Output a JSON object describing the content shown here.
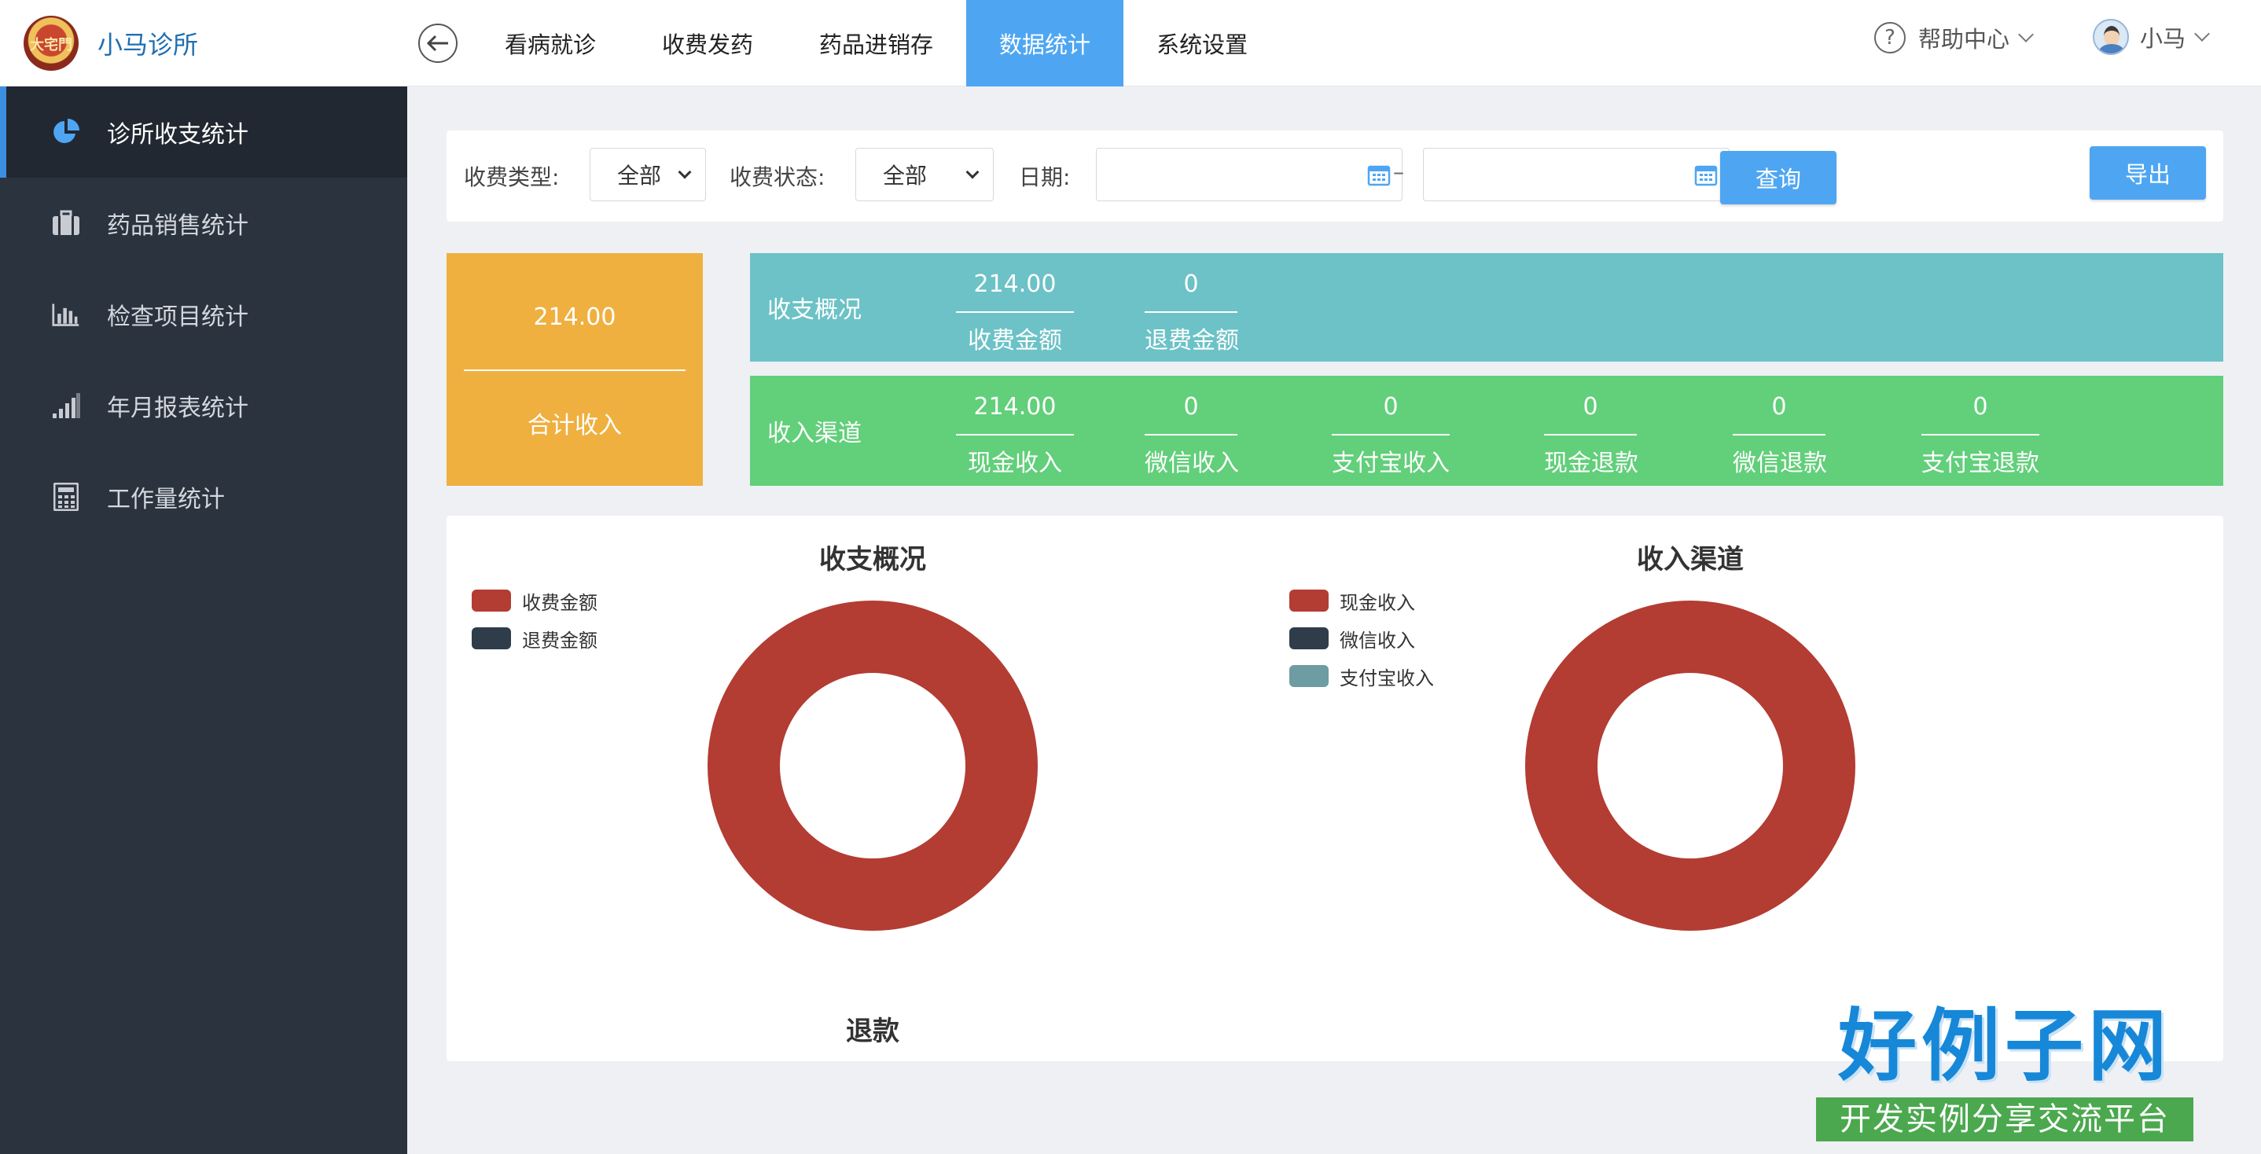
{
  "brand": {
    "logo_text": "大宅門",
    "name": "小马诊所"
  },
  "nav": {
    "items": [
      "看病就诊",
      "收费发药",
      "药品进销存",
      "数据统计",
      "系统设置"
    ],
    "active": "数据统计"
  },
  "header": {
    "help": "帮助中心",
    "user": "小马"
  },
  "sidebar": {
    "items": [
      {
        "label": "诊所收支统计",
        "icon": "pie-chart-icon"
      },
      {
        "label": "药品销售统计",
        "icon": "briefcase-icon"
      },
      {
        "label": "检查项目统计",
        "icon": "bar-chart-icon"
      },
      {
        "label": "年月报表统计",
        "icon": "signal-bars-icon"
      },
      {
        "label": "工作量统计",
        "icon": "calculator-icon"
      }
    ],
    "active": "诊所收支统计"
  },
  "filter": {
    "fee_type_label": "收费类型:",
    "fee_type_value": "全部",
    "fee_status_label": "收费状态:",
    "fee_status_value": "全部",
    "date_label": "日期:",
    "date_separator": "–",
    "date_start": "",
    "date_end": "",
    "query_button": "查询",
    "export_button": "导出"
  },
  "summary": {
    "total_amount": "214.00",
    "total_label": "合计收入",
    "overview": {
      "title": "收支概况",
      "items": [
        {
          "value": "214.00",
          "label": "收费金额"
        },
        {
          "value": "0",
          "label": "退费金额"
        }
      ]
    },
    "channel": {
      "title": "收入渠道",
      "items": [
        {
          "value": "214.00",
          "label": "现金收入"
        },
        {
          "value": "0",
          "label": "微信收入"
        },
        {
          "value": "0",
          "label": "支付宝收入"
        },
        {
          "value": "0",
          "label": "现金退款"
        },
        {
          "value": "0",
          "label": "微信退款"
        },
        {
          "value": "0",
          "label": "支付宝退款"
        }
      ]
    }
  },
  "chart_data": [
    {
      "type": "pie",
      "title": "收支概况",
      "categories": [
        "收费金额",
        "退费金额"
      ],
      "values": [
        214,
        0
      ],
      "colors": [
        "#b33c33",
        "#2f3d4b"
      ],
      "legend": "top-left"
    },
    {
      "type": "pie",
      "title": "收入渠道",
      "categories": [
        "现金收入",
        "微信收入",
        "支付宝收入"
      ],
      "values": [
        214,
        0,
        0
      ],
      "colors": [
        "#b33c33",
        "#2f3d4b",
        "#6e9ca3"
      ],
      "legend": "top-left"
    }
  ],
  "refund_chart_title": "退款",
  "watermark": {
    "main": "好例子网",
    "sub": "开发实例分享交流平台"
  },
  "colors": {
    "accent": "#4ea6f2",
    "sidebar": "#2b333e",
    "total_card": "#efb040",
    "overview_row": "#6cc2c6",
    "channel_row": "#62cf7a"
  }
}
